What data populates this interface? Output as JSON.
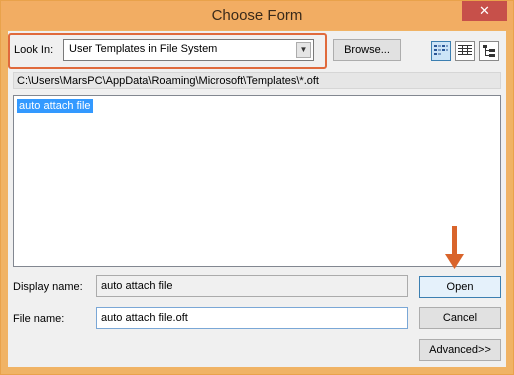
{
  "window": {
    "title": "Choose Form",
    "close_glyph": "✕"
  },
  "look_in": {
    "label": "Look In:",
    "selected": "User Templates in File System"
  },
  "browse_button": "Browse...",
  "view_buttons": [
    "list-view-icon",
    "details-view-icon",
    "tree-view-icon"
  ],
  "path": "C:\\Users\\MarsPC\\AppData\\Roaming\\Microsoft\\Templates\\*.oft",
  "files": [
    {
      "name": "auto attach file",
      "selected": true
    }
  ],
  "display_name": {
    "label": "Display name:",
    "value": "auto attach file"
  },
  "file_name": {
    "label": "File name:",
    "value": "auto attach file.oft"
  },
  "buttons": {
    "open": "Open",
    "cancel": "Cancel",
    "advanced": "Advanced>>"
  },
  "colors": {
    "title_bar": "#f2ad63",
    "close_button": "#c7504a",
    "highlight_border": "#e06a3c",
    "selection": "#3399ff"
  }
}
